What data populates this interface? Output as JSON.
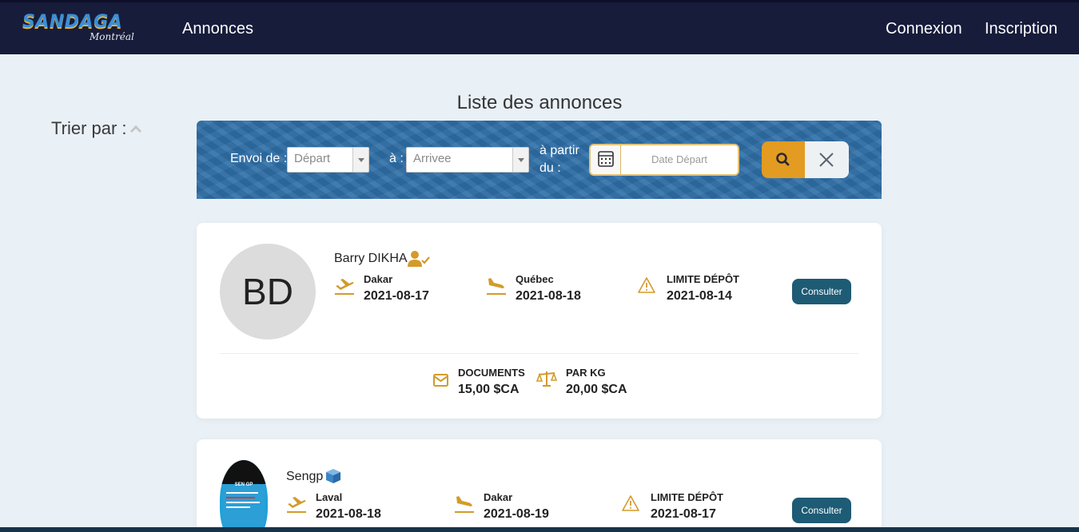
{
  "nav": {
    "logo_main": "SANDAGA",
    "logo_sub": "Montréal",
    "annonces": "Annonces",
    "connexion": "Connexion",
    "inscription": "Inscription"
  },
  "page_title": "Liste des annonces",
  "sort_label": "Trier par :",
  "filter": {
    "envoi_label": "Envoi de :",
    "depart_value": "Départ",
    "a_label": "à :",
    "arrivee_value": "Arrivee",
    "partir_label_1": "à partir",
    "partir_label_2": "du :",
    "date_placeholder": "Date Départ"
  },
  "listings": [
    {
      "initials": "BD",
      "name": "Barry DIKHA",
      "departure_city": "Dakar",
      "departure_date": "2021-08-17",
      "arrival_city": "Québec",
      "arrival_date": "2021-08-18",
      "limit_label": "LIMITE DÉPÔT",
      "limit_date": "2021-08-14",
      "consult": "Consulter",
      "documents_label": "DOCUMENTS",
      "documents_price": "15,00 $CA",
      "perkg_label": "PAR KG",
      "perkg_price": "20,00 $CA"
    },
    {
      "name": "Sengp",
      "avatar_text": "SEN GP",
      "departure_city": "Laval",
      "departure_date": "2021-08-18",
      "arrival_city": "Dakar",
      "arrival_date": "2021-08-19",
      "limit_label": "LIMITE DÉPÔT",
      "limit_date": "2021-08-17",
      "consult": "Consulter"
    }
  ],
  "colors": {
    "navbar": "#171c3b",
    "accent": "#e39b22",
    "icon_gold": "#d39b2b",
    "consult_button": "#1e5b74",
    "filter_bg": "#2f6fa8"
  }
}
